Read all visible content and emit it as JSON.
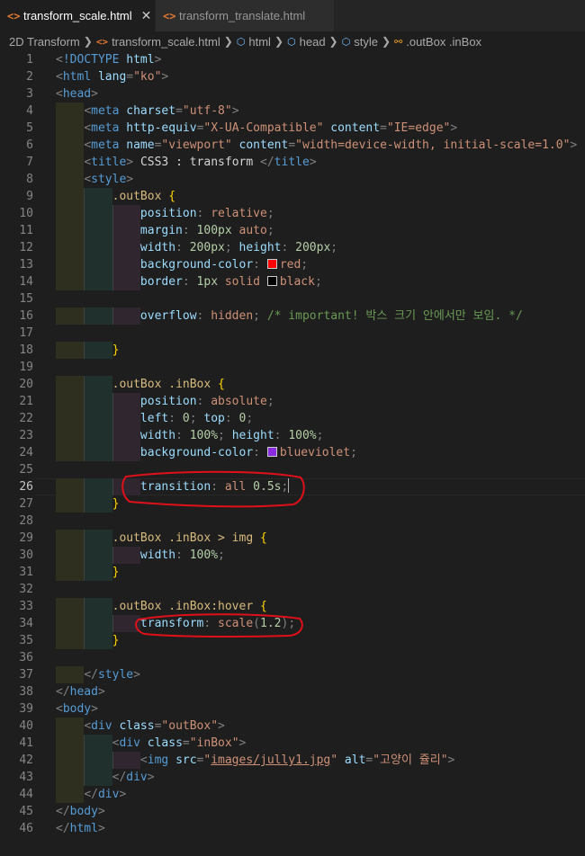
{
  "tabs": [
    {
      "label": "transform_scale.html",
      "active": true,
      "icon": "html-file-icon"
    },
    {
      "label": "transform_translate.html",
      "active": false,
      "icon": "html-file-icon"
    }
  ],
  "breadcrumb": [
    {
      "label": "2D Transform",
      "icon": ""
    },
    {
      "label": "transform_scale.html",
      "icon": "html-file-icon"
    },
    {
      "label": "html",
      "icon": "element-icon"
    },
    {
      "label": "head",
      "icon": "element-icon"
    },
    {
      "label": "style",
      "icon": "element-icon"
    },
    {
      "label": ".outBox .inBox",
      "icon": "selector-icon"
    }
  ],
  "editor": {
    "current_line": 26,
    "lines": [
      "<!DOCTYPE html>",
      "<html lang=\"ko\">",
      "<head>",
      "    <meta charset=\"utf-8\">",
      "    <meta http-equiv=\"X-UA-Compatible\" content=\"IE=edge\">",
      "    <meta name=\"viewport\" content=\"width=device-width, initial-scale=1.0\">",
      "    <title> CSS3 : transform </title>",
      "    <style>",
      "        .outBox {",
      "            position: relative;",
      "            margin: 100px auto;",
      "            width: 200px; height: 200px;",
      "            background-color: red;",
      "            border: 1px solid black;",
      "",
      "            overflow: hidden; /* important! 박스 크기 안에서만 보임. */",
      "",
      "        }",
      "",
      "        .outBox .inBox {",
      "            position: absolute;",
      "            left: 0; top: 0;",
      "            width: 100%; height: 100%;",
      "            background-color: blueviolet;",
      "",
      "            transition: all 0.5s;",
      "        }",
      "",
      "        .outBox .inBox > img {",
      "            width: 100%;",
      "        }",
      "",
      "        .outBox .inBox:hover {",
      "            transform: scale(1.2);",
      "        }",
      "",
      "    </style>",
      "</head>",
      "<body>",
      "    <div class=\"outBox\">",
      "        <div class=\"inBox\">",
      "            <img src=\"images/jully1.jpg\" alt=\"고양이 쥴리\">",
      "        </div>",
      "    </div>",
      "</body>",
      "</html>"
    ]
  },
  "colors": {
    "red_swatch": "#ff0000",
    "black_swatch": "#000000",
    "blueviolet_swatch": "#8a2be2",
    "annotation": "#e0101a"
  }
}
